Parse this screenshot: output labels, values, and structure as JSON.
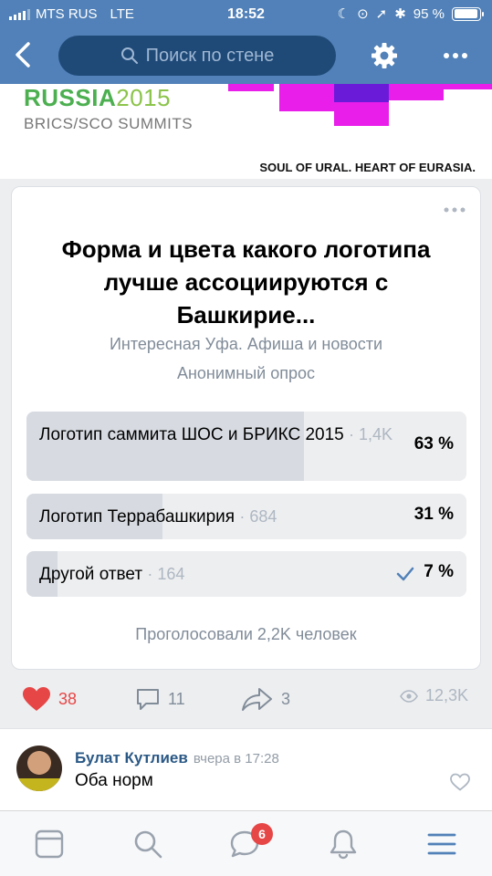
{
  "status_bar": {
    "carrier": "MTS RUS",
    "network": "LTE",
    "time": "18:52",
    "battery": "95 %",
    "battery_level": 0.95
  },
  "header": {
    "search_placeholder": "Поиск по стене"
  },
  "banner": {
    "title_main": "RUSSIA",
    "title_year": "2015",
    "subtitle": "BRICS/SCO SUMMITS",
    "tagline": "SOUL OF URAL. HEART OF EURASIA."
  },
  "poll": {
    "title": "Форма и цвета какого логотипа лучше ассоциируются с Башкирие...",
    "source": "Интересная Уфа. Афиша и новости",
    "type": "Анонимный опрос",
    "options": [
      {
        "label": "Логотип саммита ШОС и БРИКС 2015",
        "count": "· 1,4K",
        "percent": "63 %",
        "share": 0.63,
        "selected": false
      },
      {
        "label": "Логотип Террабашкирия",
        "count": "· 684",
        "percent": "31 %",
        "share": 0.31,
        "selected": false
      },
      {
        "label": "Другой ответ",
        "count": "· 164",
        "percent": "7 %",
        "share": 0.07,
        "selected": true
      }
    ],
    "total": "Проголосовали 2,2K человек"
  },
  "actions": {
    "likes": "38",
    "comments": "11",
    "shares": "3",
    "views": "12,3K"
  },
  "comment": {
    "author": "Булат Кутлиев",
    "time": "вчера в 17:28",
    "text": "Оба норм"
  },
  "tabbar": {
    "messages_badge": "6"
  },
  "colors": {
    "header": "#5181b8",
    "like": "#e64646",
    "link": "#2a5885",
    "muted": "#818c99"
  }
}
